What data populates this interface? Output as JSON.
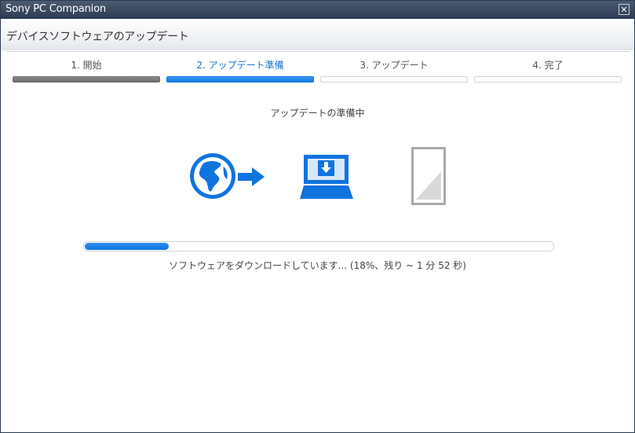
{
  "window": {
    "title": "Sony PC Companion",
    "close_label": "✕"
  },
  "header": {
    "title": "デバイスソフトウェアのアップデート"
  },
  "steps": [
    {
      "label": "1. 開始",
      "state": "done"
    },
    {
      "label": "2. アップデート準備",
      "state": "active"
    },
    {
      "label": "3. アップデート",
      "state": "pending"
    },
    {
      "label": "4. 完了",
      "state": "pending"
    }
  ],
  "status": {
    "text": "アップデートの準備中"
  },
  "icons": [
    "globe-icon",
    "arrow-right-icon",
    "laptop-download-icon",
    "phone-icon"
  ],
  "progress": {
    "percent": 18,
    "text": "ソフトウェアをダウンロードしています... (18%、残り ~ 1 分 52 秒)"
  },
  "colors": {
    "accent": "#0f74de",
    "done": "#6d6d6d",
    "titlebar": "#2c3b52",
    "device_gray": "#a9a9a9"
  }
}
